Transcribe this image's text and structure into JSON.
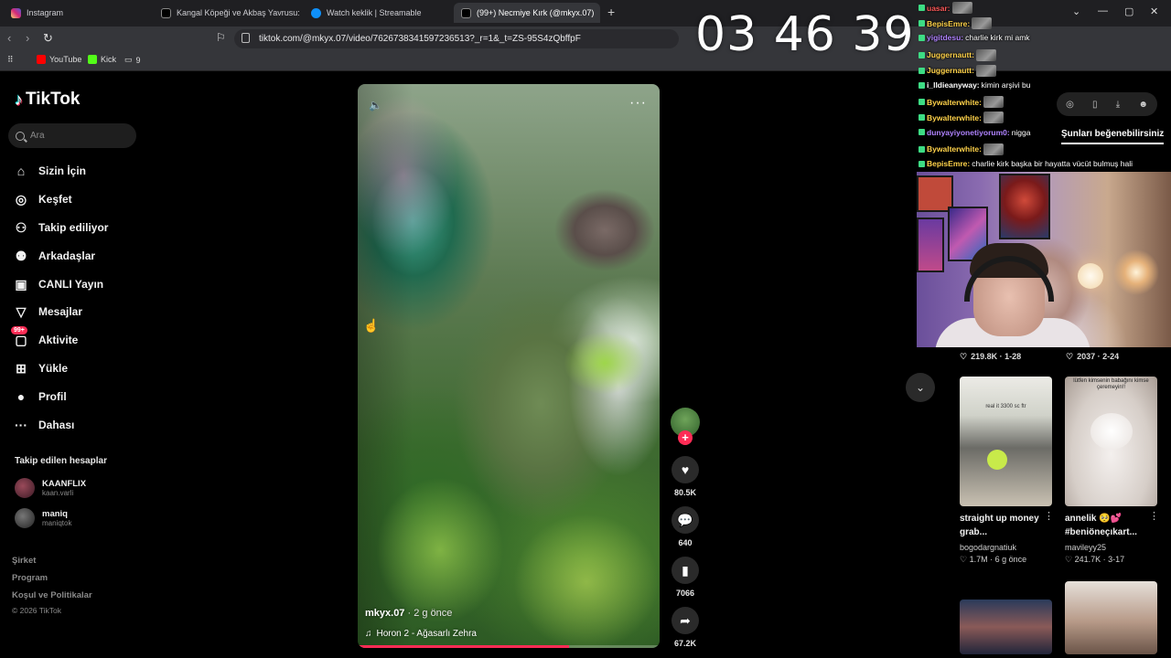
{
  "tabs": [
    {
      "title": "Instagram",
      "color": "#d6249f"
    },
    {
      "title": "Kangal Köpeği ve Akbaş Yavrusu: Eğit",
      "color": "#222"
    },
    {
      "title": "Watch keklik | Streamable",
      "color": "#0f90fa"
    },
    {
      "title": "(99+) Necmiye Kırk (@mkyx.07)",
      "color": "#222",
      "active": true
    }
  ],
  "browser": {
    "url": "tiktok.com/@mkyx.07/video/7626738341597236513?_r=1&_t=ZS-95S4zQbffpF",
    "bookmarks": [
      "YouTube",
      "Kick",
      "9"
    ]
  },
  "sidebar": {
    "logo": "TikTok",
    "search_placeholder": "Ara",
    "nav": [
      {
        "label": "Sizin İçin",
        "icon": "home-icon",
        "glyph": "⌂"
      },
      {
        "label": "Keşfet",
        "icon": "compass-icon",
        "glyph": "◎"
      },
      {
        "label": "Takip ediliyor",
        "icon": "following-icon",
        "glyph": "⚇"
      },
      {
        "label": "Arkadaşlar",
        "icon": "friends-icon",
        "glyph": "⚉"
      },
      {
        "label": "CANLI Yayın",
        "icon": "live-icon",
        "glyph": "▣"
      },
      {
        "label": "Mesajlar",
        "icon": "messages-icon",
        "glyph": "▽"
      },
      {
        "label": "Aktivite",
        "icon": "activity-icon",
        "glyph": "▢",
        "badge": "99+"
      },
      {
        "label": "Yükle",
        "icon": "upload-icon",
        "glyph": "⊞"
      },
      {
        "label": "Profil",
        "icon": "profile-icon",
        "glyph": "●"
      },
      {
        "label": "Dahası",
        "icon": "more-icon",
        "glyph": "···"
      }
    ],
    "following_title": "Takip edilen hesaplar",
    "following": [
      {
        "name": "KAANFLIX",
        "handle": "kaan.varli"
      },
      {
        "name": "maniq",
        "handle": "maniqtok"
      }
    ],
    "footer": [
      "Şirket",
      "Program",
      "Koşul ve Politikalar"
    ],
    "copyright": "© 2026 TikTok"
  },
  "video": {
    "username": "mkyx.07",
    "time": "· 2 g önce",
    "music": "Horon 2 - Ağasarlı Zehra",
    "progress": 0.7
  },
  "actions": {
    "likes": "80.5K",
    "comments": "640",
    "saves": "7066",
    "shares": "67.2K"
  },
  "clock": "03 46 39",
  "chat": [
    {
      "user": "uasar",
      "text": "",
      "color": "#ff5a5a",
      "emote": true
    },
    {
      "user": "BepisEmre",
      "text": "",
      "color": "#ffd24a",
      "emote": true
    },
    {
      "user": "yigitdesu",
      "text": " charlie kirk mi amk",
      "color": "#b083ff"
    },
    {
      "user": "Juggernautt",
      "text": "",
      "color": "#ffd24a",
      "emote": true
    },
    {
      "user": "Juggernautt",
      "text": "",
      "color": "#ffd24a",
      "emote": true
    },
    {
      "user": "i_lldieanyway",
      "text": " kimin arşivi bu",
      "color": "#ffffff"
    },
    {
      "user": "Bywalterwhite",
      "text": "",
      "color": "#ffd24a",
      "emote": true
    },
    {
      "user": "Bywalterwhite",
      "text": "",
      "color": "#ffd24a",
      "emote": true
    },
    {
      "user": "dunyayiyonetiyorum0",
      "text": " nigga",
      "color": "#b083ff"
    },
    {
      "user": "Bywalterwhite",
      "text": "",
      "color": "#ffd24a",
      "emote": true
    },
    {
      "user": "BepisEmre",
      "text": " charlie kirk başka bir hayatta vücüt bulmuş hali",
      "color": "#ffd24a"
    }
  ],
  "suggest_title": "Şunları beğenebilirsiniz",
  "feed": {
    "top_stats": [
      "219.8K · 1-28",
      "2037 · 2-24"
    ],
    "cards": [
      {
        "title": "straight up money grab...",
        "user": "bogodargnatiuk",
        "stat": "1.7M · 6 g önce",
        "thumb_text": "real it 3300 sc ftr"
      },
      {
        "title": "annelik 🥺💕 #beniöneçıkart...",
        "user": "mavileyy25",
        "stat": "241.7K · 3-17",
        "thumb_text": "lütfen kimsenin babağını kimse çeremeyin!!"
      }
    ]
  }
}
